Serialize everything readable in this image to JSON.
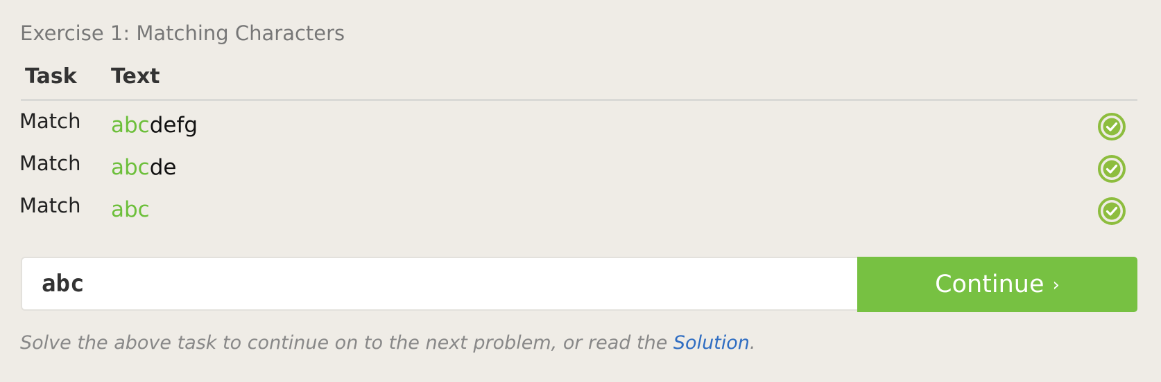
{
  "exercise": {
    "title": "Exercise 1: Matching Characters"
  },
  "table": {
    "headers": {
      "task": "Task",
      "text": "Text"
    },
    "rows": [
      {
        "task": "Match",
        "matched": "abc",
        "rest": "defg",
        "status_icon": "check-circle-icon"
      },
      {
        "task": "Match",
        "matched": "abc",
        "rest": "de",
        "status_icon": "check-circle-icon"
      },
      {
        "task": "Match",
        "matched": "abc",
        "rest": "",
        "status_icon": "check-circle-icon"
      }
    ]
  },
  "answer": {
    "value": "abc",
    "continue_label": "Continue",
    "continue_icon": "chevron-right-icon"
  },
  "hint": {
    "prefix": "Solve the above task to continue on to the next problem, or read the ",
    "link_text": "Solution",
    "suffix": "."
  },
  "colors": {
    "background": "#efece6",
    "match_highlight": "#6cbf3a",
    "continue_button": "#77c142",
    "link": "#2f6dc2",
    "check_icon": "#8dbd3e"
  }
}
